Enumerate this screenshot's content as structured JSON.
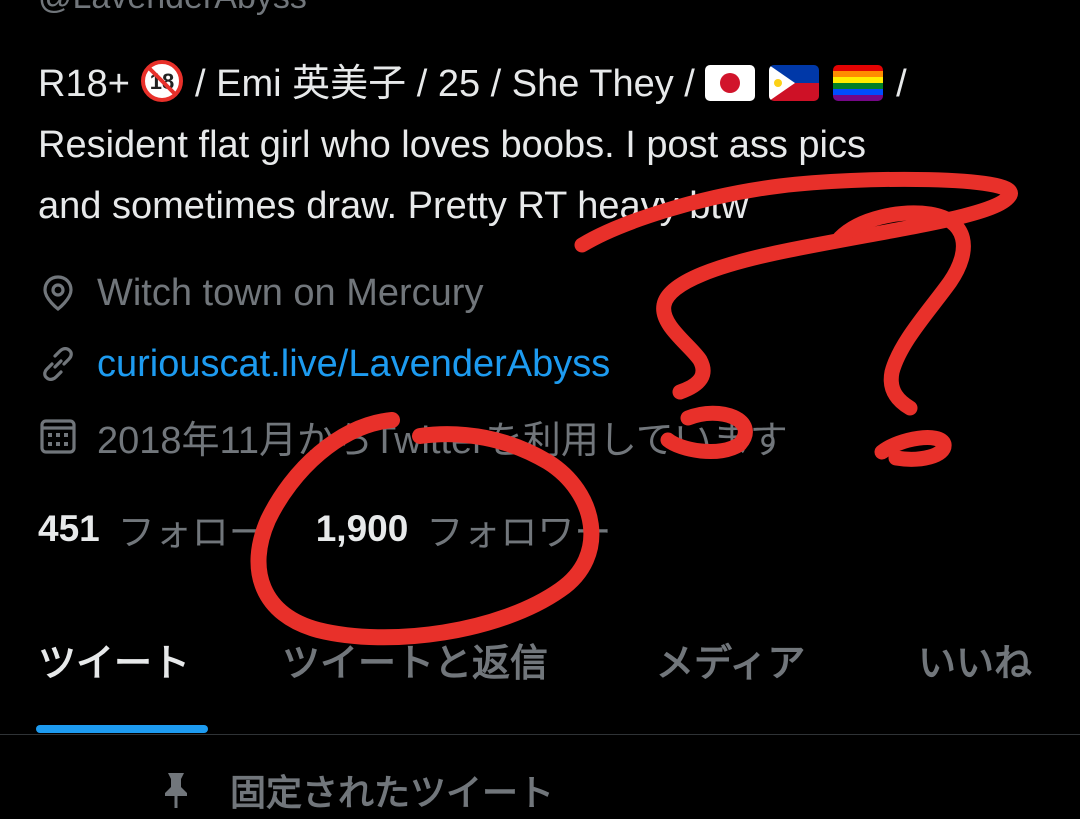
{
  "profile": {
    "handle": "@LavenderAbyss",
    "bio": {
      "line1_prefix": "R18+",
      "line1_mid": "/ Emi 英美子 / 25 / She They /",
      "line1_suffix": "/",
      "line2": "Resident flat girl who loves boobs. I post ass pics",
      "line3": "and sometimes draw. Pretty RT heavy btw"
    },
    "location": "Witch town on Mercury",
    "website": "curiouscat.live/LavenderAbyss",
    "joined": "2018年11月からTwitterを利用しています"
  },
  "stats": {
    "following_count": "451",
    "following_label": "フォロー",
    "followers_count": "1,900",
    "followers_label": "フォロワー"
  },
  "tabs": [
    "ツイート",
    "ツイートと返信",
    "メディア",
    "いいね"
  ],
  "active_tab": "ツイート",
  "pinned": {
    "label": "固定されたツイート"
  },
  "icons": {
    "no18": "no-under-18-icon",
    "flags": [
      "japan-flag-icon",
      "philippines-flag-icon",
      "rainbow-flag-icon"
    ],
    "location": "location-pin-icon",
    "link": "link-icon",
    "calendar": "calendar-icon",
    "pin": "pin-icon"
  },
  "colors": {
    "background": "#000000",
    "text": "#e7e9ea",
    "secondary": "#71767b",
    "link": "#1d9bf0",
    "annotation": "#e8302a"
  },
  "annotation": {
    "type": "hand-drawn circle around follower count with question marks"
  }
}
